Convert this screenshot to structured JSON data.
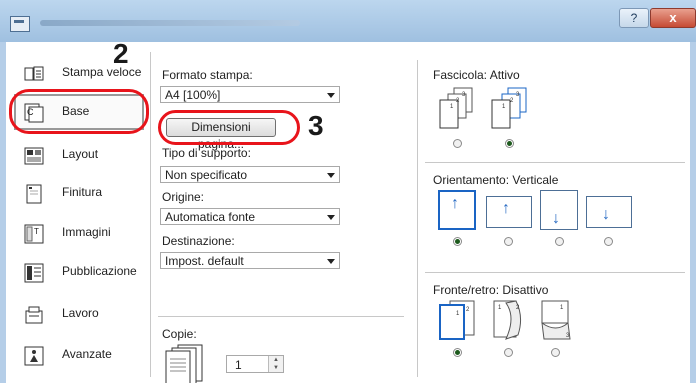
{
  "window": {
    "help_label": "?",
    "close_label": "x"
  },
  "sidebar": {
    "items": [
      {
        "label": "Stampa veloce",
        "icon": "quick-print-icon"
      },
      {
        "label": "Base",
        "icon": "basic-icon"
      },
      {
        "label": "Layout",
        "icon": "layout-icon"
      },
      {
        "label": "Finitura",
        "icon": "finishing-icon"
      },
      {
        "label": "Immagini",
        "icon": "image-icon"
      },
      {
        "label": "Pubblicazione",
        "icon": "publishing-icon"
      },
      {
        "label": "Lavoro",
        "icon": "job-icon"
      },
      {
        "label": "Avanzate",
        "icon": "advanced-icon"
      }
    ]
  },
  "form": {
    "print_size_label": "Formato stampa:",
    "print_size_value": "A4  [100%]",
    "page_size_button": "Dimensioni pagina...",
    "media_type_label": "Tipo di supporto:",
    "media_type_value": "Non specificato",
    "source_label": "Origine:",
    "source_value": "Automatica fonte",
    "destination_label": "Destinazione:",
    "destination_value": "Impost. default",
    "copies_label": "Copie:",
    "copies_value": "1"
  },
  "right_panel": {
    "collate_label": "Fascicola: Attivo",
    "orientation_label": "Orientamento: Verticale",
    "duplex_label": "Fronte/retro: Disattivo"
  },
  "callouts": {
    "step2": "2",
    "step3": "3"
  },
  "colors": {
    "callout_red": "#e8141b",
    "titlebar_blue": "#bcd6ee",
    "selection_blue": "#1a64c4"
  }
}
